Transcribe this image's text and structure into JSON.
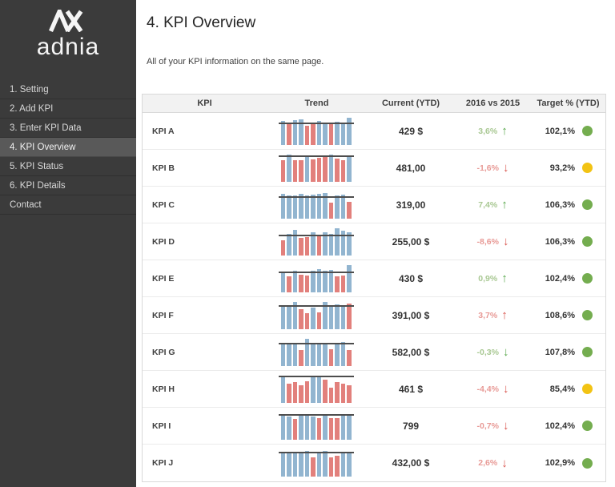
{
  "sidebar": {
    "logo_text": "adnia",
    "items": [
      {
        "label": "1. Setting",
        "active": false
      },
      {
        "label": "2. Add KPI",
        "active": false
      },
      {
        "label": "3. Enter KPI Data",
        "active": false
      },
      {
        "label": "4. KPI Overview",
        "active": true
      },
      {
        "label": "5. KPI Status",
        "active": false
      },
      {
        "label": "6. KPI Details",
        "active": false
      },
      {
        "label": "Contact",
        "active": false
      }
    ]
  },
  "main": {
    "title": "4. KPI Overview",
    "subtitle": "All of your KPI information on the same page."
  },
  "icons": {
    "up": "↑",
    "down": "↓"
  },
  "colors": {
    "bar_blue": "#92b5d0",
    "bar_red": "#e2807c",
    "trend_line": "#4d4d4d",
    "positive_text": "#a9c893",
    "positive_arrow": "#58a84c",
    "negative_text": "#e89a96",
    "negative_arrow": "#d9564f",
    "status_green": "#74ad4f",
    "status_yellow": "#f2c314"
  },
  "table": {
    "columns": [
      "KPI",
      "Trend",
      "Current (YTD)",
      "2016 vs 2015",
      "Target % (YTD)"
    ],
    "rows": [
      {
        "kpi": "KPI A",
        "current": "429 $",
        "change": "3,6%",
        "direction": "up",
        "change_color": "green",
        "target": "102,1%",
        "status": "green",
        "trend": {
          "bar_colors": [
            "blue",
            "red",
            "blue",
            "blue",
            "red",
            "red",
            "blue",
            "blue",
            "red",
            "blue",
            "blue",
            "blue"
          ],
          "bar_heights": [
            0.88,
            0.8,
            0.9,
            0.95,
            0.72,
            0.75,
            0.88,
            0.82,
            0.78,
            0.85,
            0.82,
            1.0
          ],
          "target_line": 0.8
        }
      },
      {
        "kpi": "KPI B",
        "current": "481,00",
        "change": "-1,6%",
        "direction": "down",
        "change_color": "red",
        "target": "93,2%",
        "status": "yellow",
        "trend": {
          "bar_colors": [
            "red",
            "blue",
            "red",
            "red",
            "blue",
            "red",
            "red",
            "red",
            "blue",
            "red",
            "red",
            "blue"
          ],
          "bar_heights": [
            0.8,
            1.0,
            0.78,
            0.8,
            0.95,
            0.82,
            0.88,
            0.9,
            1.0,
            0.85,
            0.78,
            0.95
          ],
          "target_line": 0.93
        }
      },
      {
        "kpi": "KPI C",
        "current": "319,00",
        "change": "7,4%",
        "direction": "up",
        "change_color": "green",
        "target": "106,3%",
        "status": "green",
        "trend": {
          "bar_colors": [
            "blue",
            "blue",
            "blue",
            "blue",
            "blue",
            "blue",
            "blue",
            "blue",
            "red",
            "blue",
            "blue",
            "red"
          ],
          "bar_heights": [
            0.9,
            0.84,
            0.86,
            0.9,
            0.84,
            0.87,
            0.9,
            0.93,
            0.6,
            0.85,
            0.88,
            0.62
          ],
          "target_line": 0.8
        }
      },
      {
        "kpi": "KPI D",
        "current": "255,00 $",
        "change": "-8,6%",
        "direction": "down",
        "change_color": "red",
        "target": "106,3%",
        "status": "green",
        "trend": {
          "bar_colors": [
            "red",
            "blue",
            "blue",
            "red",
            "red",
            "blue",
            "red",
            "blue",
            "blue",
            "blue",
            "blue",
            "blue"
          ],
          "bar_heights": [
            0.55,
            0.8,
            0.95,
            0.65,
            0.68,
            0.85,
            0.7,
            0.84,
            0.8,
            1.0,
            0.9,
            0.85
          ],
          "target_line": 0.75
        }
      },
      {
        "kpi": "KPI E",
        "current": "430 $",
        "change": "0,9%",
        "direction": "up",
        "change_color": "green",
        "target": "102,4%",
        "status": "green",
        "trend": {
          "bar_colors": [
            "blue",
            "red",
            "blue",
            "red",
            "red",
            "blue",
            "blue",
            "blue",
            "blue",
            "red",
            "red",
            "blue"
          ],
          "bar_heights": [
            0.75,
            0.6,
            0.8,
            0.64,
            0.62,
            0.78,
            0.85,
            0.8,
            0.82,
            0.6,
            0.63,
            1.0
          ],
          "target_line": 0.73
        }
      },
      {
        "kpi": "KPI F",
        "current": "391,00 $",
        "change": "3,7%",
        "direction": "up",
        "change_color": "red",
        "target": "108,6%",
        "status": "green",
        "trend": {
          "bar_colors": [
            "blue",
            "blue",
            "blue",
            "red",
            "red",
            "blue",
            "red",
            "blue",
            "blue",
            "blue",
            "blue",
            "red"
          ],
          "bar_heights": [
            0.85,
            0.84,
            1.0,
            0.74,
            0.6,
            0.8,
            0.62,
            1.0,
            0.85,
            0.9,
            0.84,
            0.95
          ],
          "target_line": 0.84
        }
      },
      {
        "kpi": "KPI G",
        "current": "582,00 $",
        "change": "-0,3%",
        "direction": "down",
        "change_color": "green",
        "target": "107,8%",
        "status": "green",
        "trend": {
          "bar_colors": [
            "blue",
            "blue",
            "blue",
            "red",
            "blue",
            "blue",
            "blue",
            "blue",
            "red",
            "blue",
            "blue",
            "red"
          ],
          "bar_heights": [
            0.8,
            0.85,
            0.8,
            0.6,
            1.0,
            0.85,
            0.82,
            0.84,
            0.62,
            0.85,
            0.88,
            0.6
          ],
          "target_line": 0.82
        }
      },
      {
        "kpi": "KPI H",
        "current": "461 $",
        "change": "-4,4%",
        "direction": "down",
        "change_color": "red",
        "target": "85,4%",
        "status": "yellow",
        "trend": {
          "bar_colors": [
            "blue",
            "red",
            "red",
            "red",
            "red",
            "blue",
            "blue",
            "red",
            "red",
            "red",
            "red",
            "red"
          ],
          "bar_heights": [
            1.0,
            0.7,
            0.75,
            0.66,
            0.8,
            1.0,
            1.0,
            0.85,
            0.55,
            0.75,
            0.72,
            0.66
          ],
          "target_line": 0.98
        }
      },
      {
        "kpi": "KPI I",
        "current": "799",
        "change": "-0,7%",
        "direction": "down",
        "change_color": "red",
        "target": "102,4%",
        "status": "green",
        "trend": {
          "bar_colors": [
            "blue",
            "blue",
            "red",
            "blue",
            "blue",
            "blue",
            "red",
            "blue",
            "red",
            "red",
            "blue",
            "blue"
          ],
          "bar_heights": [
            0.88,
            0.85,
            0.75,
            0.88,
            0.95,
            0.85,
            0.8,
            0.95,
            0.78,
            0.8,
            0.88,
            0.9
          ],
          "target_line": 0.9
        }
      },
      {
        "kpi": "KPI J",
        "current": "432,00 $",
        "change": "2,6%",
        "direction": "down",
        "change_color": "red",
        "target": "102,9%",
        "status": "green",
        "trend": {
          "bar_colors": [
            "blue",
            "blue",
            "blue",
            "blue",
            "blue",
            "red",
            "blue",
            "blue",
            "red",
            "red",
            "blue",
            "blue"
          ],
          "bar_heights": [
            0.85,
            0.84,
            0.85,
            0.86,
            0.95,
            0.7,
            0.85,
            0.95,
            0.7,
            0.75,
            0.88,
            0.9
          ],
          "target_line": 0.88
        }
      }
    ]
  }
}
